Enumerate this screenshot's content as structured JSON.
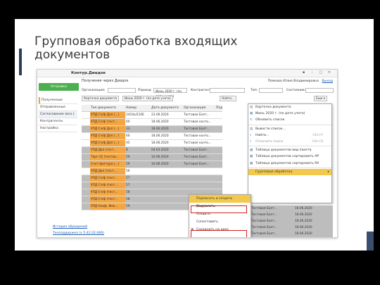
{
  "slide": {
    "title": "Групповая обработка входящих документов"
  },
  "app": {
    "title": "Контур.Диадок",
    "window_controls": "▪ ⋮ □ ✕",
    "side_action": "Отправка документов...",
    "header": "Получение через Диадок",
    "user": "Поякова Юлия Владимировна",
    "logout": "Выход",
    "filters": {
      "org_label": "Организация:",
      "period_label": "Период:",
      "period_value": "Июнь 2020 г. (по дате учета)",
      "contractor_label": "Контрагент:",
      "type_label": "Тип:",
      "state_label": "Состояние:"
    },
    "toolbar": {
      "card": "Карточка документа",
      "period": "Июнь 2020 г. (по дате учета)",
      "find": "Найти...",
      "more": "Еще ▾"
    },
    "sidebar": [
      "Полученные",
      "Отправленные",
      "Согласование (исх.)",
      "Контрагенты",
      "Настройка"
    ],
    "table": {
      "headers": [
        "",
        "Тип документа",
        "Номер",
        "Дата документа",
        "Организация",
        "Подразде"
      ],
      "rows": [
        {
          "type": "УПД Сч/ф Доп (...)",
          "num": "2410х/210Е",
          "date": "23.06.2020",
          "org": "Тестовая Балт...",
          "style": "white"
        },
        {
          "type": "УПД Сч/ф (тест...",
          "num": "40",
          "date": "18.06.2020",
          "org": "Тестовая конто...",
          "style": "white"
        },
        {
          "type": "УПД Сч/ф Доп (...)",
          "num": "33",
          "date": "18.06.2020",
          "org": "Тестовая Балт...",
          "style": "gray"
        },
        {
          "type": "УПД Сч/ф Доп (...)",
          "num": "46",
          "date": "18.06.2020",
          "org": "Тестовая конто...",
          "style": "white"
        },
        {
          "type": "УПД Сч/ф Доп (...)",
          "num": "45",
          "date": "18.06.2020",
          "org": "Тестовая конто...",
          "style": "white"
        },
        {
          "type": "УПД Доп (тест...",
          "num": "8",
          "date": "04.03.2020",
          "org": "Тестовая Балт...",
          "style": "gray"
        },
        {
          "type": "Торг-12 (тестов...",
          "num": "59",
          "date": "10.06.2020",
          "org": "Тестовая Балт...",
          "style": "gray"
        },
        {
          "type": "Счет-фактура (...)",
          "num": "59",
          "date": "10.06.2020",
          "org": "Тестовая Балт...",
          "style": "gray"
        },
        {
          "type": "УПД Доп (тест...",
          "num": "56",
          "date": "",
          "org": "",
          "style": "white"
        },
        {
          "type": "УПД Сч/ф (тест...",
          "num": "57",
          "date": "",
          "org": "",
          "style": "gray"
        },
        {
          "type": "УПД Сч/ф (тест...",
          "num": "57",
          "date": "",
          "org": "",
          "style": "gray"
        },
        {
          "type": "УПД Сч/ф (тест...",
          "num": "58",
          "date": "",
          "org": "",
          "style": "gray"
        },
        {
          "type": "УПД Сч/ф (тест...",
          "num": "58",
          "date": "",
          "org": "",
          "style": "gray"
        },
        {
          "type": "УПД Алиф. Фак...",
          "num": "59",
          "date": "",
          "org": "",
          "style": "gray"
        }
      ]
    },
    "right_rows": [
      {
        "org": "Тестовая Балт...",
        "date": "18.06.2020"
      },
      {
        "org": "Тестовая Балт...",
        "date": "18.06.2020"
      },
      {
        "org": "Тестовая Балт...",
        "date": "18.06.2020"
      },
      {
        "org": "Тестовая Балт...",
        "date": "18.06.2020"
      },
      {
        "org": "Тестовая Балт...",
        "date": "18.06.2020"
      }
    ],
    "context_menu": [
      {
        "label": "Карточка документа",
        "icon": "card-icon",
        "glyph": "▤"
      },
      {
        "label": "Июнь 2020 г. (по дате учета)",
        "icon": "calendar-icon",
        "glyph": "▦"
      },
      {
        "label": "Обновить список",
        "icon": "refresh-icon",
        "glyph": "↻"
      },
      {
        "label": "Вывести список...",
        "icon": "list-icon",
        "glyph": "▤"
      },
      {
        "label": "Найти...",
        "icon": "search-icon",
        "glyph": "⌕",
        "shortcut": "Ctrl+F"
      },
      {
        "label": "Отменить поиск",
        "icon": "cancel-search-icon",
        "glyph": "⌕",
        "shortcut": "Ctrl+Q",
        "dim": true
      },
      {
        "label": "Таблица документов вид пакета",
        "icon": "table-icon",
        "glyph": "▦"
      },
      {
        "label": "Таблица документов сортировать АР",
        "icon": "table-icon",
        "glyph": "▦"
      },
      {
        "label": "Таблица документов сортировать RA",
        "icon": "table-icon",
        "glyph": "▦"
      },
      {
        "label": "Групповая обработка",
        "icon": "none",
        "glyph": "",
        "highlight": true,
        "submenu": true
      }
    ],
    "submenu": [
      {
        "label": "Подписать и создать документы",
        "highlight": true
      },
      {
        "label": "Подписать"
      },
      {
        "label": "Создать"
      },
      {
        "label": "Сопоставить"
      },
      {
        "label": "Сохранить на диск",
        "icon": "save-icon",
        "glyph": "▣"
      }
    ],
    "footer": [
      "История обращений",
      "Техподдержка (v 5.42.02.666)"
    ]
  }
}
